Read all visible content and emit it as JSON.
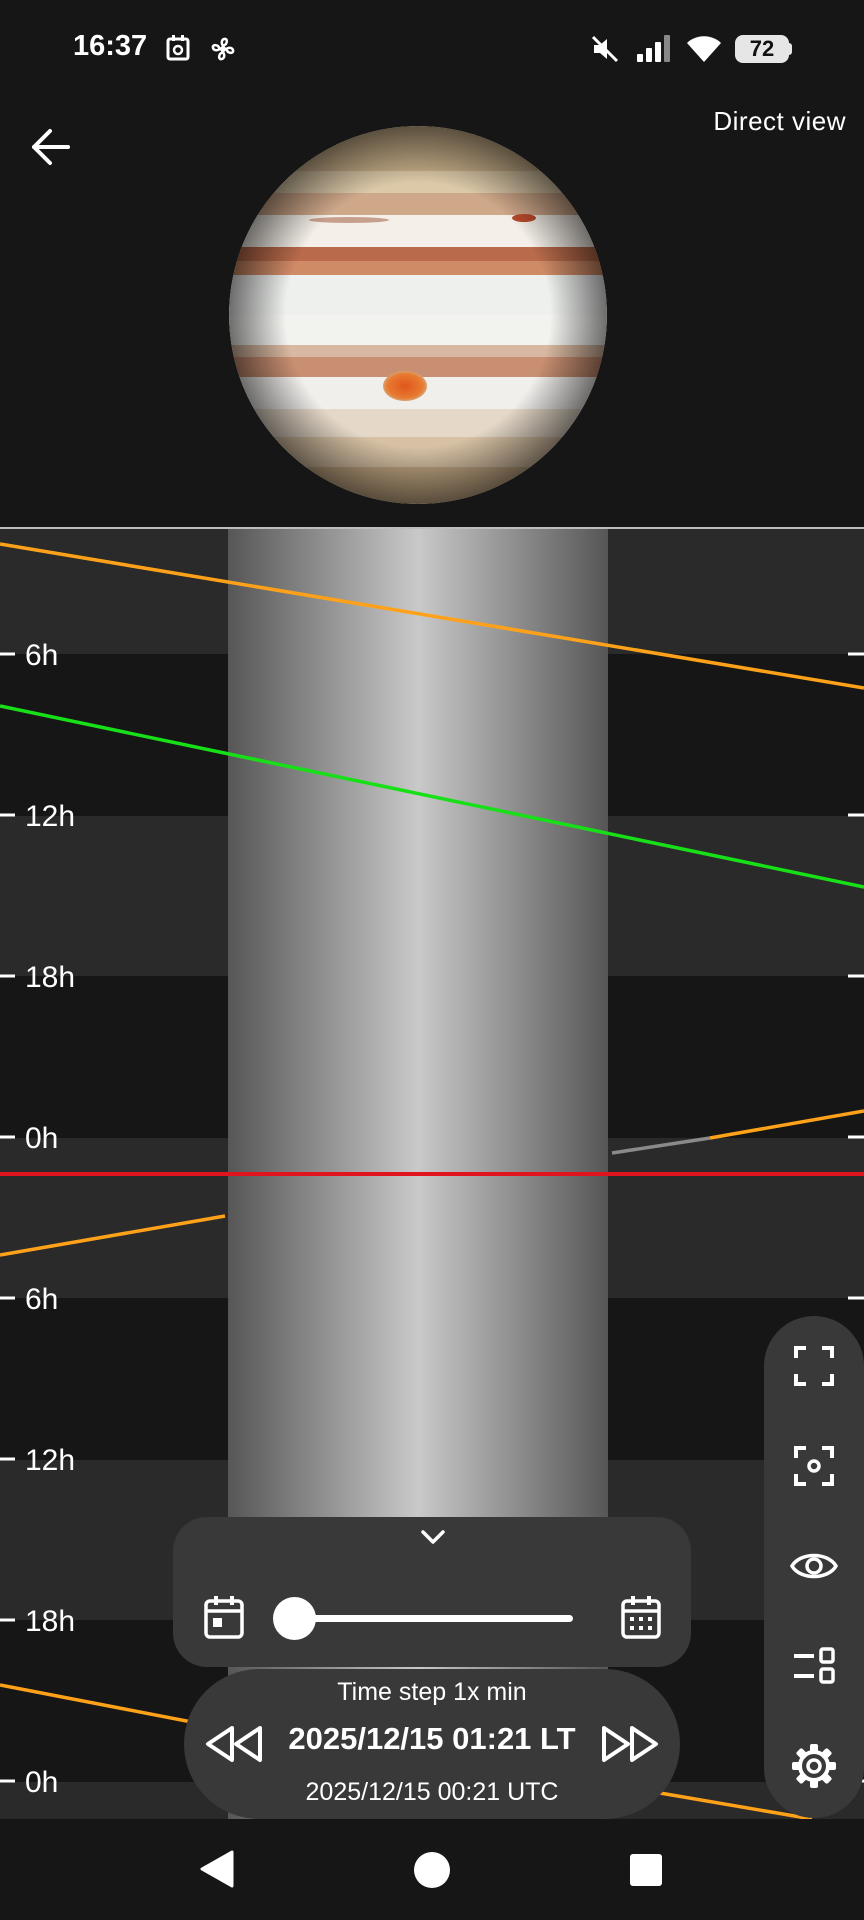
{
  "status_bar": {
    "time": "16:37",
    "battery": "72",
    "icons": [
      "calendar-alert-icon",
      "fan-icon",
      "mute-icon",
      "signal-icon",
      "wifi-icon",
      "battery-icon"
    ]
  },
  "header": {
    "back_icon": "arrow-left-icon",
    "view_mode": "Direct view",
    "planet_image": "jupiter"
  },
  "chart_data": {
    "type": "line",
    "title": "",
    "y_tick_labels": [
      "6h",
      "12h",
      "18h",
      "0h",
      "6h",
      "12h",
      "18h",
      "0h"
    ],
    "current_time_line": "2025/12/15 01:21 LT",
    "colors": {
      "orange": "#ffa21a",
      "green": "#18e018",
      "red": "#e0141c",
      "grey": "#8a8a8a"
    }
  },
  "time_controls": {
    "collapse_icon": "chevron-down-icon",
    "start_date_icon": "calendar-icon",
    "end_date_icon": "calendar-grid-icon",
    "slider_value": 0,
    "time_step": "Time step 1x min",
    "rewind_icon": "rewind-icon",
    "forward_icon": "fast-forward-icon",
    "local_time": "2025/12/15 01:21 LT",
    "utc_time": "2025/12/15 00:21 UTC"
  },
  "side_panel": {
    "buttons": [
      "fullscreen-icon",
      "center-focus-icon",
      "eye-icon",
      "layers-toggle-icon",
      "settings-icon"
    ]
  },
  "nav_bar": {
    "buttons": [
      "back-triangle-icon",
      "home-circle-icon",
      "recents-square-icon"
    ]
  }
}
